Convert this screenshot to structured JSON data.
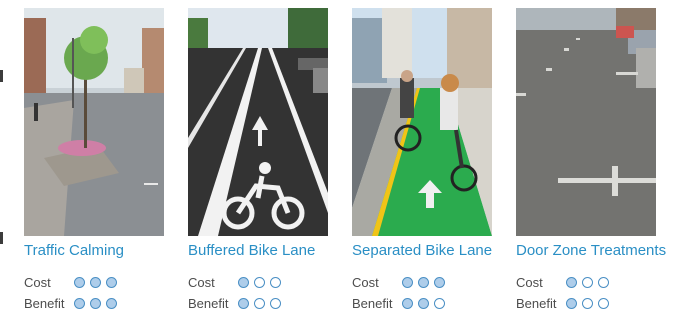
{
  "cards": [
    {
      "title": "Traffic Calming",
      "cost_label": "Cost",
      "benefit_label": "Benefit",
      "cost_rating": 3,
      "benefit_rating": 3
    },
    {
      "title": "Buffered Bike Lane",
      "cost_label": "Cost",
      "benefit_label": "Benefit",
      "cost_rating": 1,
      "benefit_rating": 1
    },
    {
      "title": "Separated Bike Lane",
      "cost_label": "Cost",
      "benefit_label": "Benefit",
      "cost_rating": 3,
      "benefit_rating": 2
    },
    {
      "title": "Door Zone Treatments",
      "cost_label": "Cost",
      "benefit_label": "Benefit",
      "cost_rating": 1,
      "benefit_rating": 1
    }
  ],
  "rating_scale_max": 3,
  "colors": {
    "title": "#2a8fc5",
    "dot_fill": "#aecdea",
    "dot_stroke": "#4a8fc4",
    "bike_lane_green": "#2bab4e"
  }
}
